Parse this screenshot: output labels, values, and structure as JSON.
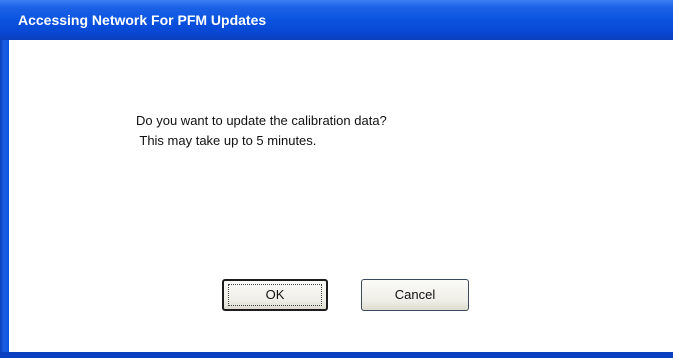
{
  "window": {
    "title": "Accessing Network For PFM Updates",
    "colors": {
      "titlebar": "#0a54e0",
      "frame": "#0a3fbf",
      "client_background": "#ffffff"
    }
  },
  "message": {
    "line1": "Do you want to update the calibration data?",
    "line2": " This may take up to 5 minutes."
  },
  "buttons": {
    "ok_label": "OK",
    "cancel_label": "Cancel",
    "default": "OK"
  }
}
